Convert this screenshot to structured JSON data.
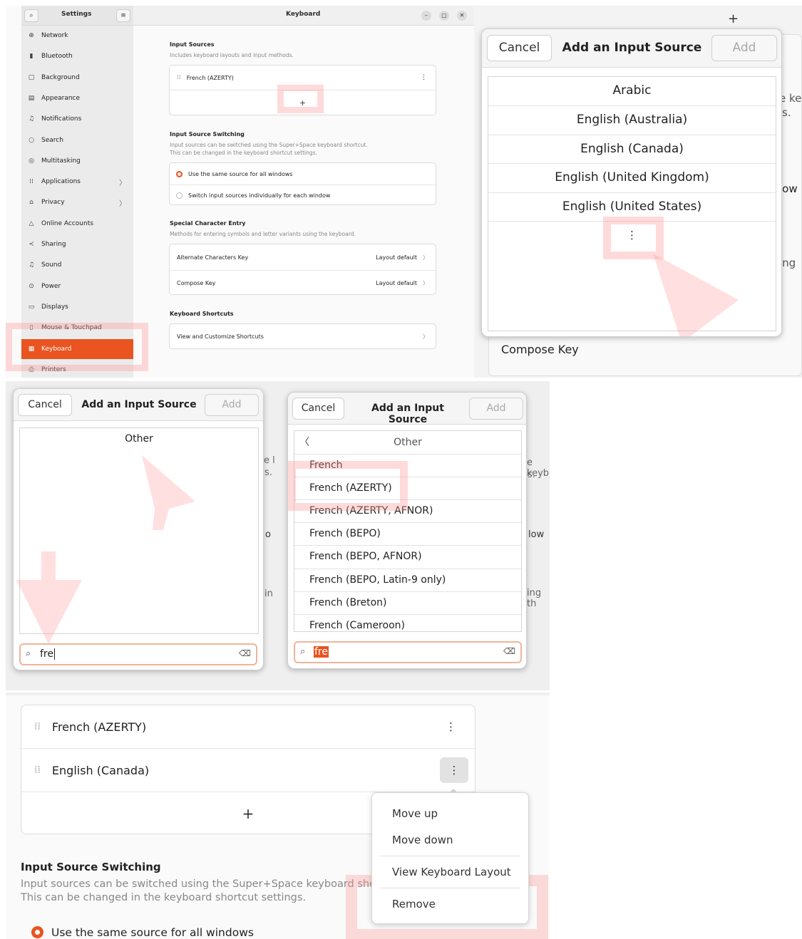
{
  "settings": {
    "title": "Settings",
    "page_title": "Keyboard",
    "sidebar": [
      {
        "label": "Network",
        "icon": "network-icon",
        "glyph": "⊕",
        "chevron": false
      },
      {
        "label": "Bluetooth",
        "icon": "bluetooth-icon",
        "glyph": "▮",
        "chevron": false
      },
      {
        "label": "Background",
        "icon": "background-icon",
        "glyph": "▢",
        "chevron": false
      },
      {
        "label": "Appearance",
        "icon": "appearance-icon",
        "glyph": "▤",
        "chevron": false
      },
      {
        "label": "Notifications",
        "icon": "bell-icon",
        "glyph": "♫",
        "chevron": false
      },
      {
        "label": "Search",
        "icon": "search-icon",
        "glyph": "○",
        "chevron": false
      },
      {
        "label": "Multitasking",
        "icon": "multitasking-icon",
        "glyph": "◎",
        "chevron": false
      },
      {
        "label": "Applications",
        "icon": "applications-icon",
        "glyph": "⁞⁞",
        "chevron": true
      },
      {
        "label": "Privacy",
        "icon": "lock-icon",
        "glyph": "⌂",
        "chevron": true
      },
      {
        "label": "Online Accounts",
        "icon": "cloud-icon",
        "glyph": "△",
        "chevron": false
      },
      {
        "label": "Sharing",
        "icon": "share-icon",
        "glyph": "≺",
        "chevron": false
      },
      {
        "label": "Sound",
        "icon": "sound-icon",
        "glyph": "♫",
        "chevron": false
      },
      {
        "label": "Power",
        "icon": "power-icon",
        "glyph": "⊙",
        "chevron": false
      },
      {
        "label": "Displays",
        "icon": "display-icon",
        "glyph": "▭",
        "chevron": false
      },
      {
        "label": "Mouse & Touchpad",
        "icon": "mouse-icon",
        "glyph": "▯",
        "chevron": false
      },
      {
        "label": "Keyboard",
        "icon": "keyboard-icon",
        "glyph": "▦",
        "chevron": false,
        "active": true
      },
      {
        "label": "Printers",
        "icon": "printer-icon",
        "glyph": "⎙",
        "chevron": false
      }
    ],
    "input_sources": {
      "heading": "Input Sources",
      "description": "Includes keyboard layouts and input methods.",
      "items": [
        "French (AZERTY)"
      ],
      "add_glyph": "+"
    },
    "switching": {
      "heading": "Input Source Switching",
      "description_1": "Input sources can be switched using the Super+Space keyboard shortcut.",
      "description_2": "This can be changed in the keyboard shortcut settings.",
      "option_same": "Use the same source for all windows",
      "option_individual": "Switch input sources individually for each window"
    },
    "special": {
      "heading": "Special Character Entry",
      "description": "Methods for entering symbols and letter variants using the keyboard.",
      "alt_key_label": "Alternate Characters Key",
      "alt_key_value": "Layout default",
      "compose_label": "Compose Key",
      "compose_value": "Layout default"
    },
    "shortcuts": {
      "heading": "Keyboard Shortcuts",
      "view_label": "View and Customize Shortcuts"
    }
  },
  "dialog": {
    "cancel": "Cancel",
    "title": "Add an Input Source",
    "add": "Add",
    "languages": [
      "Arabic",
      "English (Australia)",
      "English (Canada)",
      "English (United Kingdom)",
      "English (United States)"
    ],
    "more_glyph": "⋮",
    "bg_text": {
      "plus": "+",
      "frag1": "e ke",
      "frag2": "s.",
      "frag3": "low",
      "frag4": "ing",
      "compose": "Compose Key"
    }
  },
  "search_dialog": {
    "other_label": "Other",
    "query": "fre",
    "bg_text": {
      "a": "e l",
      "b": "s.",
      "c": "o",
      "d": "in"
    }
  },
  "results_dialog": {
    "header": "Other",
    "items": [
      "French",
      "French (AZERTY)",
      "French (AZERTY, AFNOR)",
      "French (BEPO)",
      "French (BEPO, AFNOR)",
      "French (BEPO, Latin-9 only)",
      "French (Breton)",
      "French (Cameroon)"
    ],
    "query": "fre",
    "bg_text": {
      "a": "e keyb",
      "b": "s.",
      "c": "low",
      "d": "ing th"
    }
  },
  "zoomed": {
    "sources": [
      "French (AZERTY)",
      "English (Canada)"
    ],
    "add_glyph": "+",
    "menu": [
      "Move up",
      "Move down",
      "View Keyboard Layout",
      "Remove"
    ],
    "switching_heading": "Input Source Switching",
    "switching_desc_1": "Input sources can be switched using the Super+Space keyboard sho",
    "switching_desc_2": "This can be changed in the keyboard shortcut settings.",
    "option_same": "Use the same source for all windows"
  }
}
